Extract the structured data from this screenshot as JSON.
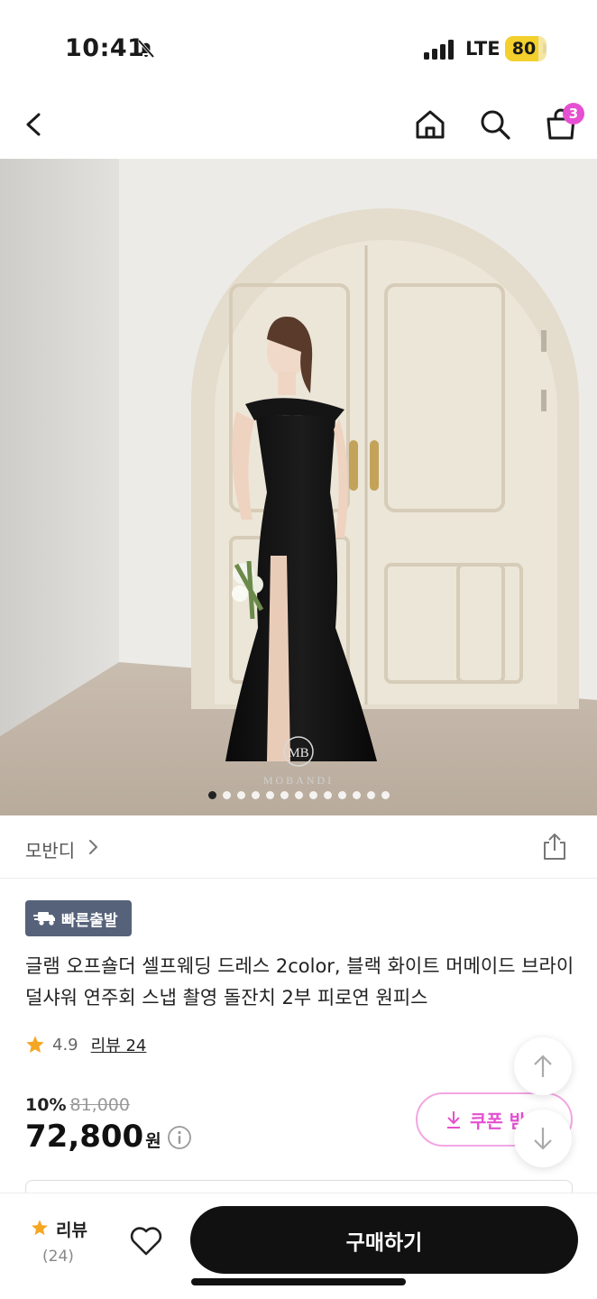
{
  "status_bar": {
    "time": "10:41",
    "network": "LTE",
    "battery": "80",
    "battery_level": 0.8
  },
  "header": {
    "cart_count": "3",
    "icons": [
      "back-icon",
      "home-icon",
      "search-icon",
      "cart-icon"
    ]
  },
  "gallery": {
    "logo_text": "MOBANDI",
    "logo_mark": "MB",
    "image_count": 13,
    "active_index": 0
  },
  "brand": {
    "name": "모반디"
  },
  "badge": {
    "label": "빠른출발"
  },
  "product": {
    "title": "글램 오프숄더 셀프웨딩 드레스 2color, 블랙 화이트 머메이드 브라이덜샤워 연주회 스냅 촬영 돌잔치 2부 피로연 원피스",
    "rating": "4.9",
    "review_label": "리뷰 24",
    "discount": "10%",
    "original_price": "81,000",
    "price": "72,800",
    "currency": "원"
  },
  "coupon": {
    "label": "쿠폰 받"
  },
  "bottom_bar": {
    "review_label": "리뷰",
    "review_count": "(24)",
    "buy_label": "구매하기"
  },
  "colors": {
    "accent": "#e64fd1",
    "badge_bg": "#56627a",
    "star": "#f5a623",
    "buy_bg": "#111111"
  }
}
